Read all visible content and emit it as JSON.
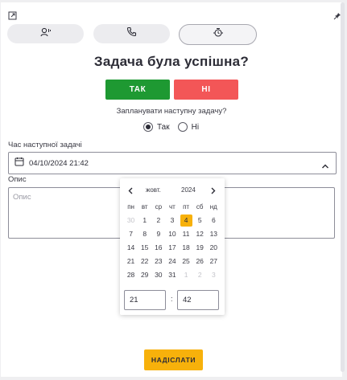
{
  "tabs": [
    {
      "icon": "user-voice-icon"
    },
    {
      "icon": "phone-icon"
    },
    {
      "icon": "alarm-icon",
      "active": true
    }
  ],
  "icons": {
    "top_left": "external-link-icon",
    "top_right": "pin-icon"
  },
  "title": "Задача була успішна?",
  "buttons": {
    "yes": "ТАК",
    "no": "НІ"
  },
  "question": "Запланувати наступну задачу?",
  "radio": {
    "yes": "Так",
    "no": "Ні",
    "selected": "yes"
  },
  "next_task": {
    "label": "Час наступної задачі",
    "value": "04/10/2024 21:42"
  },
  "description": {
    "label": "Опис",
    "placeholder": "Опис"
  },
  "datepicker": {
    "month": "жовт.",
    "year": "2024",
    "weekdays": [
      "пн",
      "вт",
      "ср",
      "чт",
      "пт",
      "сб",
      "нд"
    ],
    "weeks": [
      [
        "30",
        "1",
        "2",
        "3",
        "4",
        "5",
        "6"
      ],
      [
        "7",
        "8",
        "9",
        "10",
        "11",
        "12",
        "13"
      ],
      [
        "14",
        "15",
        "16",
        "17",
        "18",
        "19",
        "20"
      ],
      [
        "21",
        "22",
        "23",
        "24",
        "25",
        "26",
        "27"
      ],
      [
        "28",
        "29",
        "30",
        "31",
        "1",
        "2",
        "3"
      ]
    ],
    "selected_day": "4",
    "hour": "21",
    "minute": "42",
    "separator": ":"
  },
  "submit": "НАДІСЛАТИ",
  "colors": {
    "yes": "#1e9932",
    "no": "#f35657",
    "accent": "#f7b10b"
  }
}
